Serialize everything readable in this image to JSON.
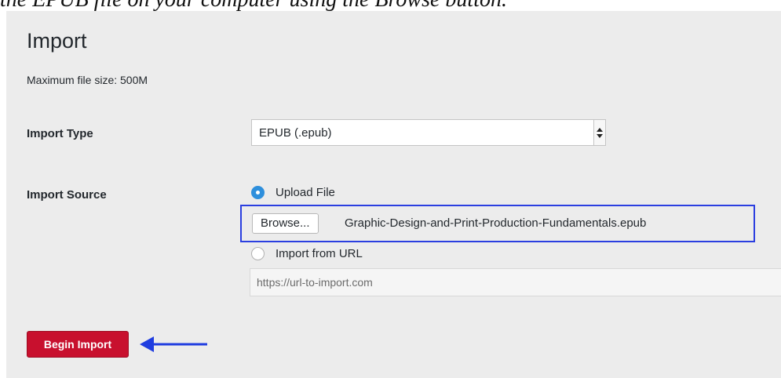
{
  "caption": {
    "text": "the EPUB file on your computer using the Browse button."
  },
  "page": {
    "title": "Import",
    "max_size_note": "Maximum file size: 500M"
  },
  "import_type": {
    "label": "Import Type",
    "selected": "EPUB (.epub)"
  },
  "import_source": {
    "label": "Import Source",
    "upload_option_label": "Upload File",
    "upload_selected": true,
    "browse_label": "Browse...",
    "file_name": "Graphic-Design-and-Print-Production-Fundamentals.epub",
    "url_option_label": "Import from URL",
    "url_placeholder": "https://url-to-import.com"
  },
  "actions": {
    "begin_label": "Begin Import"
  },
  "annotations": {
    "highlight_color": "#2b3fe0",
    "arrow_color": "#1f3de0"
  },
  "colors": {
    "panel_bg": "#ececec",
    "primary_button": "#c8102e",
    "radio_checked": "#2e8fdc"
  }
}
